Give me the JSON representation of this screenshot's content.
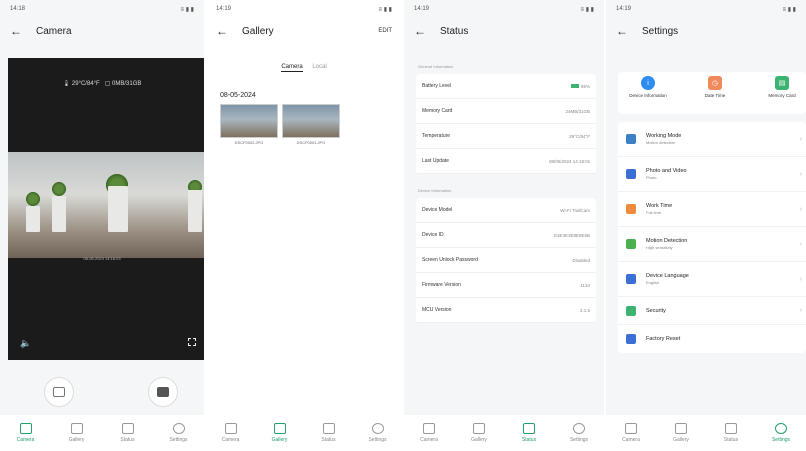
{
  "status_time": "14:18",
  "status_time_2": "14:19",
  "status_icons": "≡ ▮ ▮",
  "tabs": [
    "Camera",
    "Gallery",
    "Status",
    "Settings"
  ],
  "camera": {
    "title": "Camera",
    "temp": "29°C/84°F",
    "storage": "0MB/31GB",
    "timestamp": "08-05-2024 14:18:23"
  },
  "gallery": {
    "title": "Gallery",
    "edit": "EDIT",
    "seg_camera": "Camera",
    "seg_local": "Local",
    "date": "08-05-2024",
    "files": [
      "DSCF0002.JPG",
      "DSCF0001.JPG"
    ]
  },
  "status": {
    "title": "Status",
    "general_label": "General Information",
    "device_label": "Device Information",
    "general": [
      {
        "k": "Battery Level",
        "v": "85%"
      },
      {
        "k": "Memory Card",
        "v": "24MB/31GB"
      },
      {
        "k": "Temperature",
        "v": "29°C/84°F"
      },
      {
        "k": "Last Update",
        "v": "08/05/2024 14:18:0s"
      }
    ],
    "device": [
      {
        "k": "Device Model",
        "v": "Wi-Fi TrailCam"
      },
      {
        "k": "Device ID",
        "v": "E3E3E3E8E9E5B"
      },
      {
        "k": "Screen Unlock Password",
        "v": "Disabled"
      },
      {
        "k": "Firmware Version",
        "v": "1134"
      },
      {
        "k": "MCU Version",
        "v": "2.1.5"
      }
    ]
  },
  "settings": {
    "title": "Settings",
    "quick": [
      {
        "label": "Device Information",
        "color": "#2d8cf0",
        "glyph": "i"
      },
      {
        "label": "Date Time",
        "color": "#f08a5d",
        "glyph": "◷"
      },
      {
        "label": "Memory Card",
        "color": "#3cb371",
        "glyph": "▤"
      }
    ],
    "items": [
      {
        "title": "Working Mode",
        "sub": "Motion detection",
        "color": "#3b82c4"
      },
      {
        "title": "Photo and Video",
        "sub": "Photo",
        "color": "#3b6fd6"
      },
      {
        "title": "Work Time",
        "sub": "Full time",
        "color": "#f08a3c"
      },
      {
        "title": "Motion Detection",
        "sub": "High sensitivity",
        "color": "#4caf50"
      },
      {
        "title": "Device Language",
        "sub": "English",
        "color": "#3b6fd6"
      },
      {
        "title": "Security",
        "sub": "",
        "color": "#3cb371"
      },
      {
        "title": "Factory Reset",
        "sub": "",
        "color": "#3b6fd6"
      }
    ]
  }
}
